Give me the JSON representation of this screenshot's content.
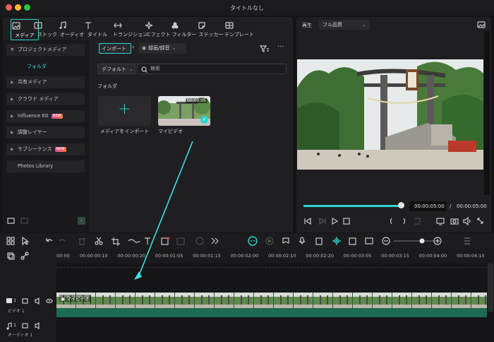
{
  "window": {
    "title": "タイトルなし"
  },
  "toolbar": {
    "media": "メディア",
    "stock": "ストック",
    "audio": "オーディオ",
    "titles": "タイトル",
    "transitions": "トランジション",
    "effects": "エフェクト",
    "filters": "フィルター",
    "stickers": "ステッカー",
    "templates": "テンプレート"
  },
  "sidebar": {
    "project_media": "プロジェクトメディア",
    "folder": "フォルダ",
    "shared_media": "共有メディア",
    "cloud_media": "クラウド メディア",
    "influence_kit": "Influence Kit",
    "adjustment_layer": "調整レイヤー",
    "subsequence": "サブシーケンス",
    "photos_library": "Photos Library",
    "new_badge": "NEW"
  },
  "media": {
    "import_label": "インポート",
    "record_label": "録画/録音",
    "sort_label": "デフォルト",
    "search_placeholder": "検索",
    "folder_section": "フォルダ",
    "import_tile_label": "メディアをインポート",
    "clip_label": "マイビデオ",
    "clip_duration": "00:00:05"
  },
  "player": {
    "play_label": "再生",
    "quality": "フル品質",
    "current_time": "00:00:05:00",
    "separator": "/",
    "total_time": "00:00:05:00",
    "progress": 0.97
  },
  "timeline": {
    "ticks": [
      "00:00",
      "00:00:00:10",
      "00:00:00:20",
      "00:00:01:05",
      "00:00:01:15",
      "00:00:02:00",
      "00:00:02:10",
      "00:00:02:20",
      "00:00:03:05",
      "00:00:03:15",
      "00:00:04:00",
      "00:00:04:10"
    ],
    "video_track_label": "ビデオ 1",
    "video_track_num": "1",
    "audio_track_label": "オーディオ 1",
    "audio_track_num": "1",
    "clip_label": "マイビデオ"
  },
  "colors": {
    "accent": "#2fd4d0"
  }
}
